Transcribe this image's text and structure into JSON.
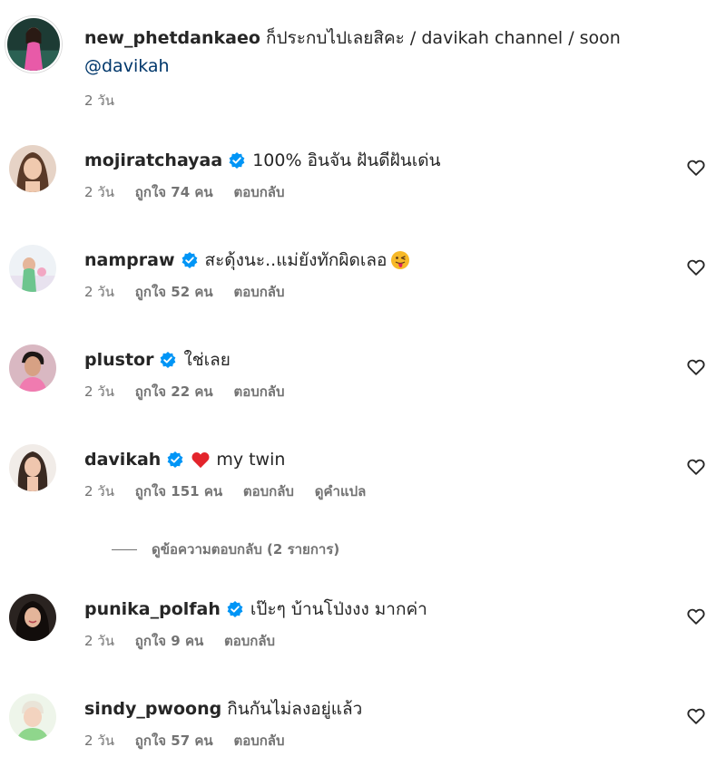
{
  "caption": {
    "username": "new_phetdankaeo",
    "text": "ก็ประกบไปเลยสิคะ / davikah channel / soon",
    "mention": "@davikah",
    "time": "2 วัน"
  },
  "comments": [
    {
      "username": "mojiratchayaa",
      "verified": true,
      "text": "100% อินจัน ฝันดีฝันเด่น",
      "time": "2 วัน",
      "likes": "ถูกใจ 74 คน",
      "reply": "ตอบกลับ"
    },
    {
      "username": "nampraw",
      "verified": true,
      "text": "สะดุ้งนะ..แม่ยังทักผิดเลอ",
      "emoji": "tongue-out-face",
      "time": "2 วัน",
      "likes": "ถูกใจ 52 คน",
      "reply": "ตอบกลับ"
    },
    {
      "username": "plustor",
      "verified": true,
      "text": "ใช่เลย",
      "time": "2 วัน",
      "likes": "ถูกใจ 22 คน",
      "reply": "ตอบกลับ"
    },
    {
      "username": "davikah",
      "verified": true,
      "emoji": "red-heart",
      "text": "my twin",
      "time": "2 วัน",
      "likes": "ถูกใจ 151 คน",
      "reply": "ตอบกลับ",
      "translate": "ดูคำแปล"
    },
    {
      "username": "punika_polfah",
      "verified": true,
      "text": "เป๊ะๆ บ้านโป่งงง มากค่า",
      "time": "2 วัน",
      "likes": "ถูกใจ 9 คน",
      "reply": "ตอบกลับ"
    },
    {
      "username": "sindy_pwoong",
      "verified": false,
      "text": "กินกันไม่ลงอยู่แล้ว",
      "time": "2 วัน",
      "likes": "ถูกใจ 57 คน",
      "reply": "ตอบกลับ"
    }
  ],
  "view_replies": "ดูข้อความตอบกลับ (2 รายการ)",
  "colors": {
    "text": "#262626",
    "secondary": "#737373",
    "mention": "#00376b",
    "verified": "#0095f6",
    "heart": "#ed4956"
  }
}
